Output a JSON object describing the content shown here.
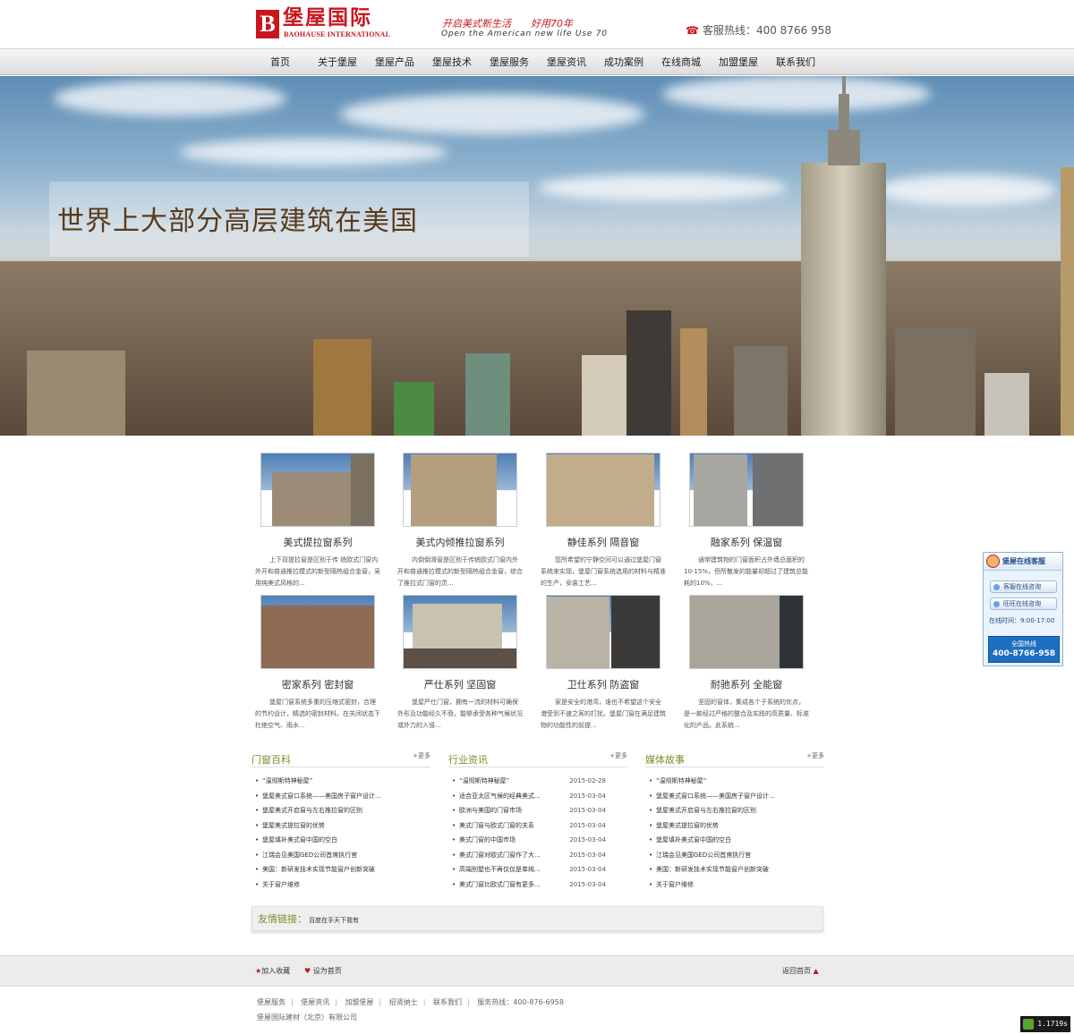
{
  "header": {
    "logo_mark": "B",
    "logo_cn": "堡屋国际",
    "logo_en": "BAOHAUSE INTERNATIONAL",
    "slogan_cn": "开启美式新生活　　好用70年",
    "slogan_en": "Open the American new life  Use 70",
    "hotline_label": "客服热线：400 8766 958",
    "phone_icon": "phone-icon"
  },
  "nav": {
    "items": [
      "首页",
      "关于堡屋",
      "堡屋产品",
      "堡屋技术",
      "堡屋服务",
      "堡屋资讯",
      "成功案例",
      "在线商城",
      "加盟堡屋",
      "联系我们"
    ]
  },
  "banner": {
    "title": "世界上大部分高层建筑在美国"
  },
  "products": [
    {
      "name": "美式提拉窗系列",
      "desc": "上下双提拉窗是区别于传 统欧式门窗内外开和普通推拉模式的新型隔热组合金窗，采用纯美式风格的..."
    },
    {
      "name": "美式内倾推拉窗系列",
      "desc": "内倒倒滑窗是区别于传统欧式门窗内外开和普通推拉模式的新型隔热组合金窗，综合了推拉式门窗的灵..."
    },
    {
      "name": "静佳系列 隔音窗",
      "desc": "您所希望的宁静空间可以通过堡屋门窗系统来实现，堡屋门窗系统选用的材料与精准的生产，安装工艺..."
    },
    {
      "name": "融家系列 保温窗",
      "desc": "通常建筑物的门窗面积占外墙总面积的10-15%，但所散发的能量却超过了建筑总能耗的10%，..."
    },
    {
      "name": "密家系列 密封窗",
      "desc": "堡屋门窗系统多重的压缩式密封，合理的节约设计，精选的密封材料。在关闭状态下杜绝空气、雨水..."
    },
    {
      "name": "严仕系列 坚固窗",
      "desc": "堡屋严仕门窗，拥有一流的材料可确保外形及功能经久不衰，能够承受各种气候状况或外力的入侵..."
    },
    {
      "name": "卫仕系列 防盗窗",
      "desc": "家是安全的港湾，谁也不希望这个安全港受到不速之客的打扰。堡屋门窗在满足建筑物的功能性的前提..."
    },
    {
      "name": "耐驰系列 全能窗",
      "desc": "坚固的窗体，集成各个子系统的优点，是一款经过严格的整合及实践的高质量、标准化的产品。此系统..."
    }
  ],
  "columns": [
    {
      "title": "门窗百科",
      "more": "+更多",
      "items": [
        {
          "text": "“温彻斯特神秘屋”",
          "date": ""
        },
        {
          "text": "堡屋美式窗口系统——美国房子窗户设计...",
          "date": ""
        },
        {
          "text": "堡屋美式开启窗与左右推拉窗的区别",
          "date": ""
        },
        {
          "text": "堡屋美式提拉窗的优势",
          "date": ""
        },
        {
          "text": "堡屋填补美式窗中国的空白",
          "date": ""
        },
        {
          "text": "江瑞会见美国GED公司首席执行官",
          "date": ""
        },
        {
          "text": "美国：新研发技术实现节能窗户创新突破",
          "date": ""
        },
        {
          "text": "关于窗户维修",
          "date": ""
        }
      ]
    },
    {
      "title": "行业资讯",
      "more": "+更多",
      "items": [
        {
          "text": "“温彻斯特神秘屋”",
          "date": "2015-02-28"
        },
        {
          "text": "适合亚太区气候的经典美式...",
          "date": "2015-03-04"
        },
        {
          "text": "欧洲与美国的门窗市场",
          "date": "2015-03-04"
        },
        {
          "text": "美式门窗与欧式门窗的关系",
          "date": "2015-03-04"
        },
        {
          "text": "美式门窗的中国市场",
          "date": "2015-03-04"
        },
        {
          "text": "美式门窗对欧式门窗作了大...",
          "date": "2015-03-04"
        },
        {
          "text": "高端别墅也不再仅仅是单纯...",
          "date": "2015-03-04"
        },
        {
          "text": "美式门窗比欧式门窗有更多...",
          "date": "2015-03-04"
        }
      ]
    },
    {
      "title": "媒体故事",
      "more": "+更多",
      "items": [
        {
          "text": "“温彻斯特神秘屋”",
          "date": ""
        },
        {
          "text": "堡屋美式窗口系统——美国房子窗户设计...",
          "date": ""
        },
        {
          "text": "堡屋美式开启窗与左右推拉窗的区别",
          "date": ""
        },
        {
          "text": "堡屋美式提拉窗的优势",
          "date": ""
        },
        {
          "text": "堡屋填补美式窗中国的空白",
          "date": ""
        },
        {
          "text": "江瑞会见美国GED公司首席执行官",
          "date": ""
        },
        {
          "text": "美国：新研发技术实现节能窗户创新突破",
          "date": ""
        },
        {
          "text": "关于窗户维修",
          "date": ""
        }
      ]
    }
  ],
  "links": {
    "title": "友情链接：",
    "items": [
      "百度在手天下我有"
    ]
  },
  "footer": {
    "fav": "加入收藏",
    "home": "设为首页",
    "top": "返回首页",
    "links": [
      "堡屋服务",
      "堡屋资讯",
      "加盟堡屋",
      "招贤纳士",
      "联系我们",
      "服务热线：400-876-6958"
    ],
    "copyright": "堡屋国际建材（北京）有限公司"
  },
  "service": {
    "title": "堡屋在线客服",
    "btn1": "客服在线咨询",
    "btn2": "旺旺在线咨询",
    "time": "在线时间：9:00-17:00",
    "hot_label": "全国热线",
    "hot_number": "400-8766-958"
  },
  "timer": "1.1719s",
  "colors": {
    "brand_red": "#c8161d",
    "accent_green": "#7a8e2a",
    "service_blue": "#1e6fc0"
  }
}
